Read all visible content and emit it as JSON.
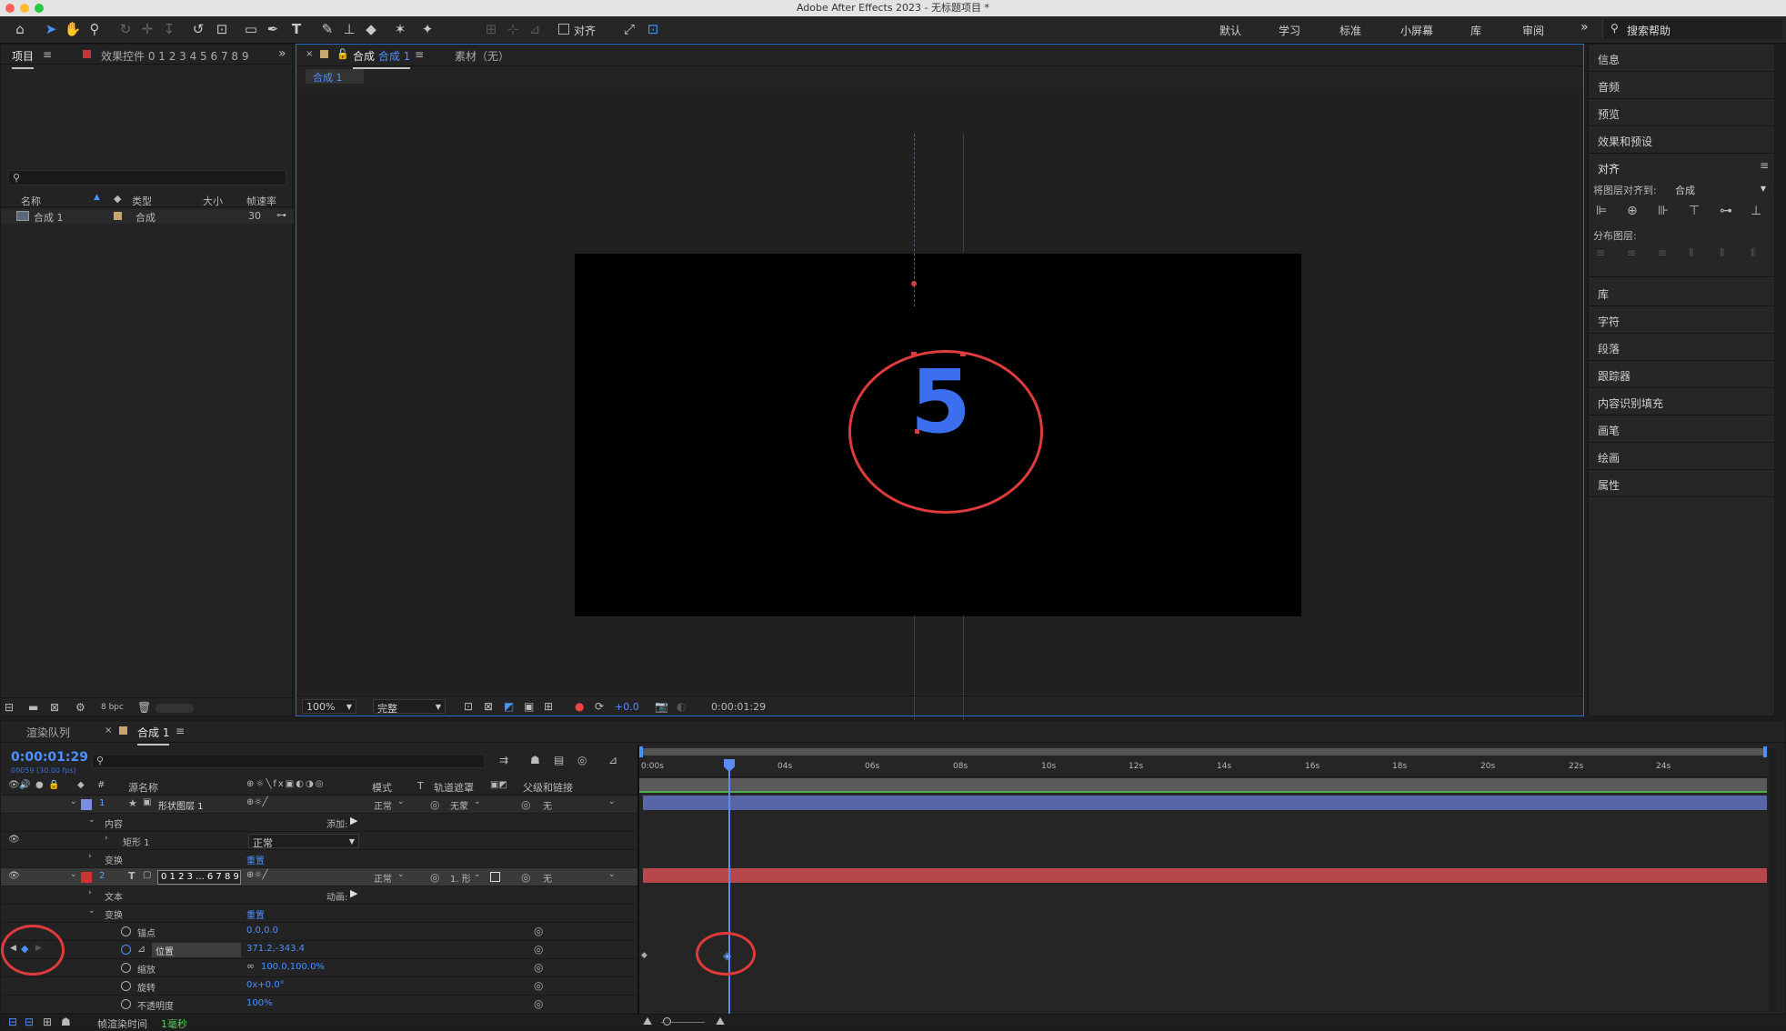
{
  "app_title": "Adobe After Effects 2023 - 无标题项目 *",
  "toolbar": {
    "align_label": "对齐",
    "workspaces": [
      "默认",
      "学习",
      "标准",
      "小屏幕",
      "库",
      "审阅"
    ],
    "search_placeholder": "搜索帮助"
  },
  "project_panel": {
    "tab_project": "项目",
    "tab_effects": "效果控件 0 1 2 3 4 5 6 7 8 9",
    "columns": {
      "name": "名称",
      "type": "类型",
      "size": "大小",
      "fps": "帧速率"
    },
    "item": {
      "name": "合成 1",
      "type": "合成",
      "fps": "30"
    },
    "bpc": "8 bpc"
  },
  "comp_panel": {
    "tab_prefix": "合成",
    "tab_name": "合成 1",
    "footage_tab": "素材（无）",
    "breadcrumb": "合成 1",
    "digit": "5",
    "zoom": "100%",
    "quality": "完整",
    "exposure": "+0.0",
    "timecode": "0:00:01:29"
  },
  "right_panel": {
    "top_items": [
      "信息",
      "音频",
      "预览",
      "效果和预设"
    ],
    "align_title": "对齐",
    "align_to_label": "将图层对齐到:",
    "align_to_value": "合成",
    "distribute_label": "分布图层:",
    "bottom_items": [
      "库",
      "字符",
      "段落",
      "跟踪器",
      "内容识别填充",
      "画笔",
      "绘画",
      "属性"
    ]
  },
  "timeline": {
    "tab_render": "渲染队列",
    "tab_comp": "合成 1",
    "timecode": "0:00:01:29",
    "frame_info": "00059 (30.00 fps)",
    "headers": {
      "source": "源名称",
      "mode": "模式",
      "t": "T",
      "matte": "轨道遮罩",
      "parent": "父级和链接"
    },
    "ruler": [
      "0:00s",
      "04s",
      "06s",
      "08s",
      "10s",
      "12s",
      "14s",
      "16s",
      "18s",
      "20s",
      "22s",
      "24s"
    ],
    "layer1": {
      "num": "1",
      "name": "形状图层 1",
      "mode": "正常",
      "matte": "无蒙",
      "parent": "无"
    },
    "content": "内容",
    "add": "添加:",
    "rect": "矩形 1",
    "rect_mode": "正常",
    "transform": "变换",
    "reset": "重置",
    "layer2": {
      "num": "2",
      "name": "0 1 2 3 ... 6 7 8 9",
      "mode": "正常",
      "matte": "1. 形",
      "parent": "无"
    },
    "text": "文本",
    "animate": "动画:",
    "transform2": "变换",
    "reset2": "重置",
    "props": [
      {
        "name": "锚点",
        "value": "0.0,0.0"
      },
      {
        "name": "位置",
        "value": "371.2,-343.4"
      },
      {
        "name": "缩放",
        "value": "100.0,100.0%"
      },
      {
        "name": "旋转",
        "value": "0x+0.0°"
      },
      {
        "name": "不透明度",
        "value": "100%"
      }
    ],
    "render_time_label": "帧渲染时间",
    "render_time_value": "1毫秒"
  }
}
